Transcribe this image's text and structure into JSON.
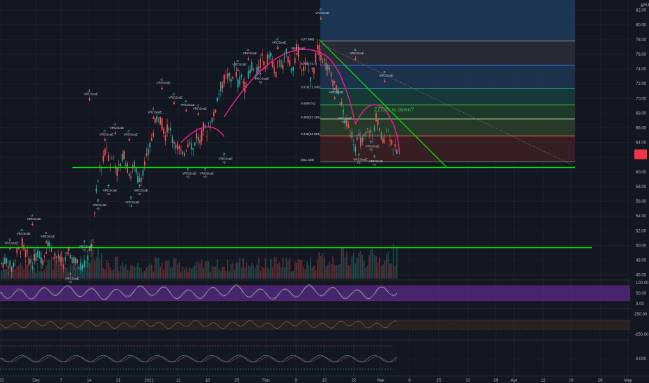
{
  "colors": {
    "background": "#131722",
    "grid": "#1e222d",
    "up": "#26a69a",
    "down": "#ef5350",
    "support": "#00e000",
    "arc": "#e91e8c",
    "signal_up": "#26a69a",
    "signal_down": "#ef5350",
    "rsi_band": "#5b2a86",
    "price_tag": "#f23645"
  },
  "chart_data": {
    "type": "candlestick",
    "currency": "EUR",
    "price_axis_ticks": [
      "82.00",
      "80.00",
      "78.00",
      "76.00",
      "74.00",
      "72.00",
      "70.00",
      "68.00",
      "66.00",
      "64.00",
      "62.00",
      "60.00",
      "58.00",
      "56.00",
      "54.00",
      "52.00",
      "50.00",
      "48.00",
      "46.00"
    ],
    "price_axis_top_label": "6",
    "ylim": [
      45.5,
      83.0
    ],
    "time_axis_ticks": [
      "23",
      "Dec",
      "7",
      "14",
      "21",
      "2021",
      "11",
      "18",
      "25",
      "Feb",
      "8",
      "15",
      "22",
      "Mar",
      "8",
      "15",
      "22",
      "29",
      "Apr",
      "12",
      "19",
      "26",
      "May"
    ],
    "price_path": [
      [
        0,
        47.5
      ],
      [
        3,
        48
      ],
      [
        6,
        46.8
      ],
      [
        9,
        49
      ],
      [
        12,
        50
      ],
      [
        15,
        48.5
      ],
      [
        18,
        47.5
      ],
      [
        21,
        49
      ],
      [
        24,
        48
      ],
      [
        27,
        50.5
      ],
      [
        30,
        49
      ],
      [
        33,
        48.2
      ],
      [
        36,
        47.5
      ],
      [
        39,
        49
      ],
      [
        42,
        48
      ],
      [
        45,
        47.2
      ],
      [
        48,
        47.6
      ],
      [
        51,
        48.8
      ],
      [
        53,
        51
      ],
      [
        55,
        57
      ],
      [
        57,
        60.5
      ],
      [
        59,
        61.5
      ],
      [
        61,
        63.5
      ],
      [
        63,
        61
      ],
      [
        65,
        62.2
      ],
      [
        67,
        60
      ],
      [
        69,
        61
      ],
      [
        71,
        62.5
      ],
      [
        73,
        60.5
      ],
      [
        75,
        59.5
      ],
      [
        77,
        61
      ],
      [
        79,
        59
      ],
      [
        81,
        59.5
      ],
      [
        83,
        61
      ],
      [
        85,
        62.5
      ],
      [
        87,
        64.5
      ],
      [
        89,
        66.5
      ],
      [
        91,
        68
      ],
      [
        93,
        66.5
      ],
      [
        95,
        65
      ],
      [
        97,
        66.5
      ],
      [
        99,
        64.5
      ],
      [
        101,
        64
      ],
      [
        103,
        63
      ],
      [
        105,
        62
      ],
      [
        107,
        63.5
      ],
      [
        109,
        64.5
      ],
      [
        111,
        63
      ],
      [
        113,
        65
      ],
      [
        115,
        64
      ],
      [
        117,
        66
      ],
      [
        119,
        65.5
      ],
      [
        121,
        66.8
      ],
      [
        123,
        67.5
      ],
      [
        125,
        70
      ],
      [
        127,
        71.5
      ],
      [
        129,
        72.5
      ],
      [
        131,
        73
      ],
      [
        133,
        72.5
      ],
      [
        135,
        74
      ],
      [
        137,
        72
      ],
      [
        139,
        73
      ],
      [
        141,
        71.5
      ],
      [
        143,
        73
      ],
      [
        145,
        74.5
      ],
      [
        147,
        73
      ],
      [
        149,
        74
      ],
      [
        151,
        75.5
      ],
      [
        153,
        74.5
      ],
      [
        155,
        76
      ],
      [
        157,
        75
      ],
      [
        159,
        73
      ],
      [
        161,
        75.5
      ],
      [
        163,
        74
      ],
      [
        165,
        76
      ],
      [
        167,
        75
      ],
      [
        169,
        74
      ],
      [
        171,
        76.5
      ],
      [
        173,
        75
      ],
      [
        175,
        74
      ],
      [
        177,
        74.5
      ],
      [
        179,
        73
      ],
      [
        181,
        74
      ],
      [
        183,
        77
      ],
      [
        185,
        76
      ],
      [
        187,
        75
      ],
      [
        189,
        74
      ],
      [
        191,
        73
      ],
      [
        193,
        72
      ],
      [
        195,
        70.5
      ],
      [
        197,
        69
      ],
      [
        199,
        67
      ],
      [
        201,
        66
      ],
      [
        203,
        65
      ],
      [
        205,
        63.5
      ],
      [
        207,
        64.5
      ],
      [
        209,
        64
      ],
      [
        211,
        65
      ],
      [
        213,
        66
      ],
      [
        215,
        64.5
      ],
      [
        217,
        67.5
      ],
      [
        219,
        65.5
      ],
      [
        221,
        64
      ],
      [
        223,
        66
      ],
      [
        225,
        65
      ],
      [
        227,
        63.5
      ],
      [
        229,
        62.5
      ]
    ],
    "volume_path": [
      [
        0,
        0.3
      ],
      [
        10,
        0.5
      ],
      [
        20,
        0.4
      ],
      [
        30,
        0.6
      ],
      [
        40,
        0.35
      ],
      [
        50,
        0.7
      ],
      [
        54,
        1.0
      ],
      [
        60,
        0.6
      ],
      [
        70,
        0.5
      ],
      [
        80,
        0.45
      ],
      [
        90,
        0.55
      ],
      [
        100,
        0.5
      ],
      [
        110,
        0.4
      ],
      [
        120,
        0.5
      ],
      [
        130,
        0.45
      ],
      [
        140,
        0.6
      ],
      [
        150,
        0.5
      ],
      [
        160,
        0.55
      ],
      [
        170,
        0.5
      ],
      [
        180,
        0.6
      ],
      [
        190,
        0.7
      ],
      [
        200,
        0.8
      ],
      [
        210,
        0.75
      ],
      [
        220,
        0.7
      ],
      [
        229,
        0.9
      ]
    ],
    "support_lines": [
      {
        "y": 60.6
      },
      {
        "y": 49.7
      }
    ],
    "trendline": {
      "from": [
        184,
        78.0
      ],
      "to": [
        258,
        60.6
      ]
    },
    "dashed_trend": {
      "from": [
        186,
        77.3
      ],
      "to": [
        330,
        61.0
      ]
    },
    "fib_levels": [
      {
        "label": "1(77.806)",
        "y": 77.8,
        "color": "#787b86"
      },
      {
        "label": "0.786(74.7)",
        "y": 74.5,
        "color": "#3179f5"
      },
      {
        "label": "0.618(71.345)",
        "y": 71.3,
        "color": "#26a69a"
      },
      {
        "label": "0.5(69.01)",
        "y": 69.1,
        "color": "#4caf50"
      },
      {
        "label": "0.382(67.191)",
        "y": 67.2,
        "color": "#a5d6a7"
      },
      {
        "label": "0.236(64.983)",
        "y": 64.9,
        "color": "#ef5350"
      },
      {
        "label": "0(61.429)",
        "y": 61.4,
        "color": "#787b86"
      }
    ],
    "annotation": "ZZOS: w down?",
    "current_price_tag": "",
    "signal_label": "VRCScaE",
    "signal_label_alt": "VRCScaLE",
    "signal_count": "+2",
    "signal_count_neg": "-2",
    "signals": [
      {
        "x": 5,
        "y": 49.7,
        "dir": "down",
        "label": "VRCScaE",
        "count": "-2"
      },
      {
        "x": 18,
        "y": 53,
        "dir": "down",
        "label": "VRCScaE",
        "count": "-2"
      },
      {
        "x": 12,
        "y": 51,
        "dir": "down",
        "label": "VRCScaE",
        "count": "-2"
      },
      {
        "x": 26,
        "y": 50.6,
        "dir": "down",
        "label": "VRCScaE",
        "count": "-2"
      },
      {
        "x": 40,
        "y": 46,
        "dir": "up",
        "label": "VRCScaE",
        "count": "+2"
      },
      {
        "x": 48,
        "y": 50.4,
        "dir": "up",
        "label": "VRCScaE",
        "count": "+2"
      },
      {
        "x": 51,
        "y": 70,
        "dir": "down",
        "label": "VRCScaE",
        "count": "-2"
      },
      {
        "x": 60,
        "y": 64.5,
        "dir": "down",
        "label": "VRCScaE",
        "count": "-2"
      },
      {
        "x": 66,
        "y": 65.4,
        "dir": "down",
        "label": "VRCScaE",
        "count": "-2"
      },
      {
        "x": 74,
        "y": 64.5,
        "dir": "down",
        "label": "VRCScaE",
        "count": "-2"
      },
      {
        "x": 56,
        "y": 56,
        "dir": "up",
        "label": "VRCScaE",
        "count": "+2"
      },
      {
        "x": 62,
        "y": 58,
        "dir": "up",
        "label": "VRCScaE",
        "count": "+2"
      },
      {
        "x": 75,
        "y": 56.4,
        "dir": "up",
        "label": "VRCScaE",
        "count": "+2"
      },
      {
        "x": 80,
        "y": 58,
        "dir": "up",
        "label": "VRCScaE",
        "count": "+2"
      },
      {
        "x": 88,
        "y": 67.5,
        "dir": "down",
        "label": "VRCScaE",
        "count": "-2"
      },
      {
        "x": 93,
        "y": 71.5,
        "dir": "down",
        "label": "VRCScaE",
        "count": "-2"
      },
      {
        "x": 100,
        "y": 69.5,
        "dir": "down",
        "label": "VRCScaE",
        "count": "-2"
      },
      {
        "x": 107,
        "y": 68.5,
        "dir": "down",
        "label": "VRCScaE",
        "count": "-2"
      },
      {
        "x": 114,
        "y": 68,
        "dir": "down",
        "label": "VRCScaE",
        "count": "-2"
      },
      {
        "x": 108,
        "y": 60.3,
        "dir": "up",
        "label": "VRCScaE",
        "count": "+2"
      },
      {
        "x": 118,
        "y": 60.3,
        "dir": "up",
        "label": "VRCScaE",
        "count": "+2"
      },
      {
        "x": 129,
        "y": 62.3,
        "dir": "up",
        "label": "VRCScaE",
        "count": "+2"
      },
      {
        "x": 137,
        "y": 74,
        "dir": "down",
        "label": "VRCScaE",
        "count": "-2"
      },
      {
        "x": 143,
        "y": 75.5,
        "dir": "down",
        "label": "VRCScaE",
        "count": "-2"
      },
      {
        "x": 150,
        "y": 73.2,
        "dir": "up",
        "label": "VRCScaE",
        "count": "+2"
      },
      {
        "x": 160,
        "y": 77,
        "dir": "down",
        "label": "VRCScaE",
        "count": "-2"
      },
      {
        "x": 171,
        "y": 76.2,
        "dir": "down",
        "label": "VRCScaE",
        "count": "-2"
      },
      {
        "x": 185,
        "y": 81,
        "dir": "down",
        "label": "VRCScaE",
        "count": "-2"
      },
      {
        "x": 193,
        "y": 70.2,
        "dir": "down",
        "label": "VRCScaE",
        "count": "-2"
      },
      {
        "x": 198,
        "y": 67.8,
        "dir": "up",
        "label": "VRCScaE",
        "count": "+2"
      },
      {
        "x": 205,
        "y": 75.5,
        "dir": "down",
        "label": "VRCScaE",
        "count": "-2"
      },
      {
        "x": 207,
        "y": 62.2,
        "dir": "up",
        "label": "VRCScaE",
        "count": "+2"
      },
      {
        "x": 214,
        "y": 64,
        "dir": "up",
        "label": "VRCScaE",
        "count": "+2"
      },
      {
        "x": 222,
        "y": 72.5,
        "dir": "down",
        "label": "VRCScaE",
        "count": "-2"
      },
      {
        "x": 216,
        "y": 62,
        "dir": "up",
        "label": "VRCScaE",
        "count": "+2"
      }
    ],
    "rsi_ticks": [
      "100.00",
      "50.00",
      "0.00"
    ],
    "osc2_ticks": [
      "250.00",
      "-250.00"
    ],
    "osc3_ticks": [
      "0.000"
    ]
  }
}
